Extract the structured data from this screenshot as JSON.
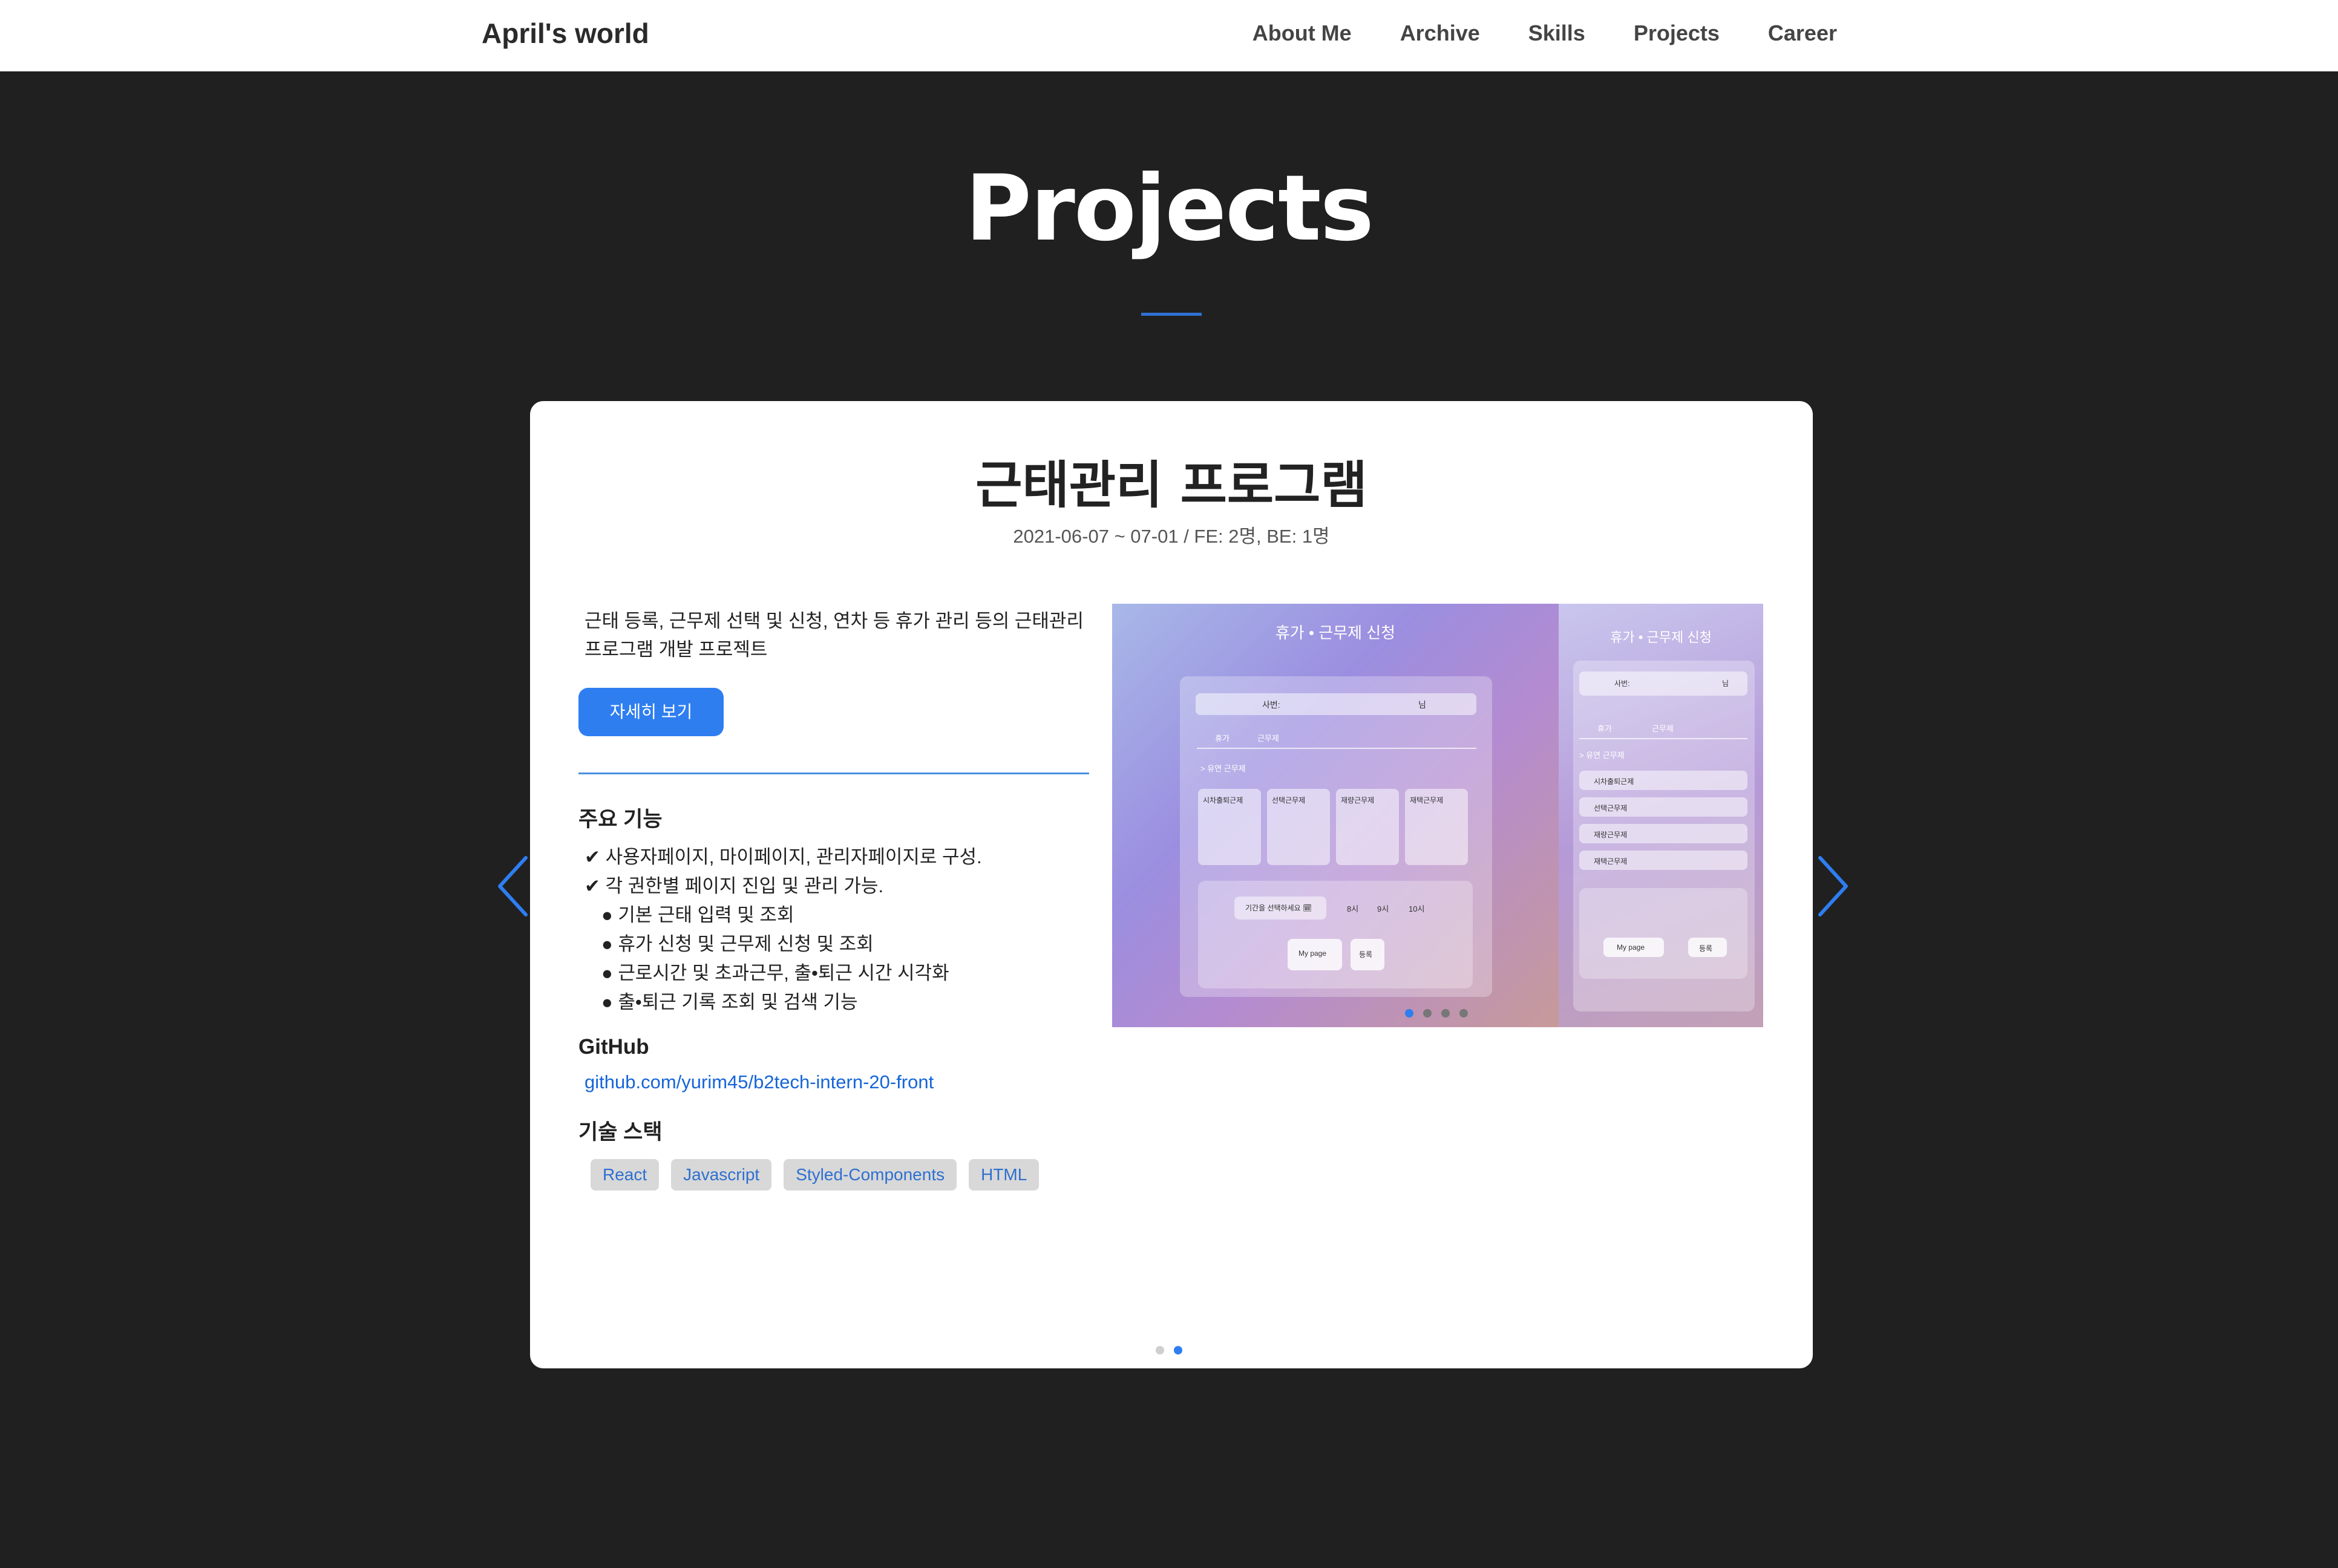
{
  "nav": {
    "brand": "April's world",
    "items": [
      "About Me",
      "Archive",
      "Skills",
      "Projects",
      "Career"
    ]
  },
  "section": {
    "title": "Projects"
  },
  "project": {
    "title": "근태관리 프로그램",
    "meta": "2021-06-07 ~ 07-01 / FE: 2명, BE: 1명",
    "description": "근태 등록, 근무제 선택 및 신청, 연차 등 휴가 관리 등의 근태관리 프로그램 개발 프로젝트",
    "detail_button": "자세히 보기",
    "features_heading": "주요 기능",
    "features": [
      "✔ 사용자페이지, 마이페이지, 관리자페이지로 구성.",
      "✔ 각 권한별 페이지 진입 및 관리 가능."
    ],
    "sub_features": [
      "● 기본 근태 입력 및 조회",
      "● 휴가 신청 및 근무제 신청 및 조회",
      "● 근로시간 및 초과근무, 출•퇴근 시간 시각화",
      "● 출•퇴근 기록 조회 및 검색 기능"
    ],
    "github_heading": "GitHub",
    "github_link": "github.com/yurim45/b2tech-intern-20-front",
    "stack_heading": "기술 스택",
    "stack": [
      "React",
      "Javascript",
      "Styled-Components",
      "HTML"
    ]
  },
  "screenshot": {
    "title": "휴가 • 근무제 신청",
    "field_label": "사번:",
    "field_suffix": "님",
    "tabs": [
      "휴가",
      "근무제"
    ],
    "section_label": "> 유연 근무제",
    "options": [
      "시차출퇴근제",
      "선택근무제",
      "재량근무제",
      "재택근무제"
    ],
    "date_button": "기간을 선택하세요 🗓",
    "times": [
      "8시",
      "9시",
      "10시"
    ],
    "mypage": "My page",
    "submit": "등록"
  },
  "carousel": {
    "active_index": 1,
    "count": 2,
    "slides_inner_count": 4,
    "inner_active_index": 0
  },
  "colors": {
    "accent": "#2e7ef0",
    "link": "#1565d8",
    "background": "#202020"
  }
}
